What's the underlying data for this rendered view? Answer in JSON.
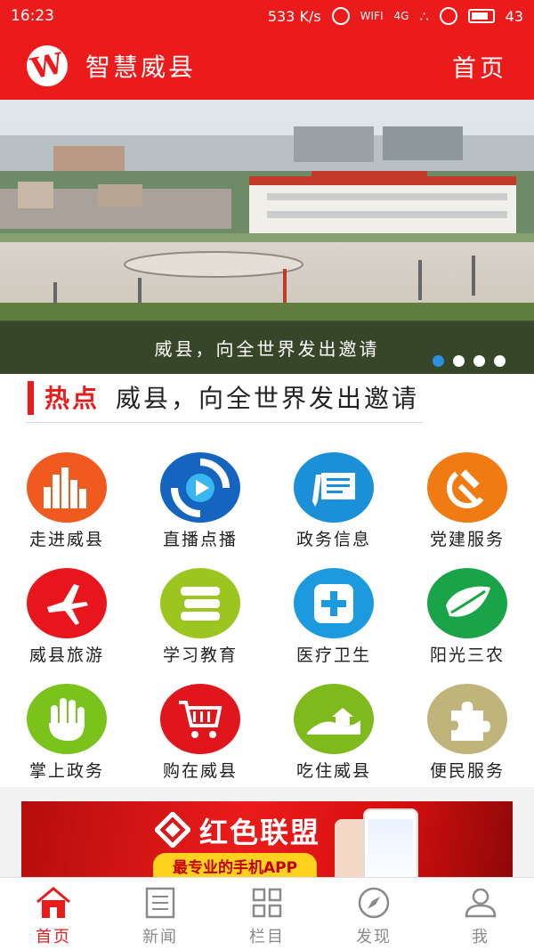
{
  "statusbar": {
    "time": "16:23",
    "network_speed": "533 K/s",
    "signal_label": "4G",
    "battery": "43"
  },
  "header": {
    "title": "智慧威县",
    "home_link": "首页",
    "colors": {
      "brand": "#ec1b1b"
    }
  },
  "banner": {
    "caption": "威县，向全世界发出邀请",
    "slides": 4,
    "active_slide": 1
  },
  "hot": {
    "label": "热点",
    "headline": "威县，向全世界发出邀请"
  },
  "services": [
    {
      "label": "走进威县",
      "icon": "city-skyline-icon",
      "color": "#f05a1f"
    },
    {
      "label": "直播点播",
      "icon": "play-circle-icon",
      "color": "#1565c0"
    },
    {
      "label": "政务信息",
      "icon": "document-pen-icon",
      "color": "#1b8fd8"
    },
    {
      "label": "党建服务",
      "icon": "hammer-sickle-icon",
      "color": "#f07b12"
    },
    {
      "label": "威县旅游",
      "icon": "airplane-icon",
      "color": "#e8161c"
    },
    {
      "label": "学习教育",
      "icon": "books-icon",
      "color": "#9cc520"
    },
    {
      "label": "医疗卫生",
      "icon": "medical-cross-icon",
      "color": "#1b9ae0"
    },
    {
      "label": "阳光三农",
      "icon": "leaf-icon",
      "color": "#1aa44a"
    },
    {
      "label": "掌上政务",
      "icon": "hand-icon",
      "color": "#7bc21c"
    },
    {
      "label": "购在威县",
      "icon": "shopping-cart-icon",
      "color": "#e0161c"
    },
    {
      "label": "吃住威县",
      "icon": "house-landscape-icon",
      "color": "#7fba1d"
    },
    {
      "label": "便民服务",
      "icon": "puzzle-icon",
      "color": "#bfb57a"
    }
  ],
  "ad": {
    "title": "红色联盟",
    "subtitle": "最专业的手机APP"
  },
  "tabbar": [
    {
      "label": "首页",
      "icon": "home-icon",
      "active": true
    },
    {
      "label": "新闻",
      "icon": "news-icon",
      "active": false
    },
    {
      "label": "栏目",
      "icon": "grid-icon",
      "active": false
    },
    {
      "label": "发现",
      "icon": "compass-icon",
      "active": false
    },
    {
      "label": "我",
      "icon": "user-icon",
      "active": false
    }
  ]
}
